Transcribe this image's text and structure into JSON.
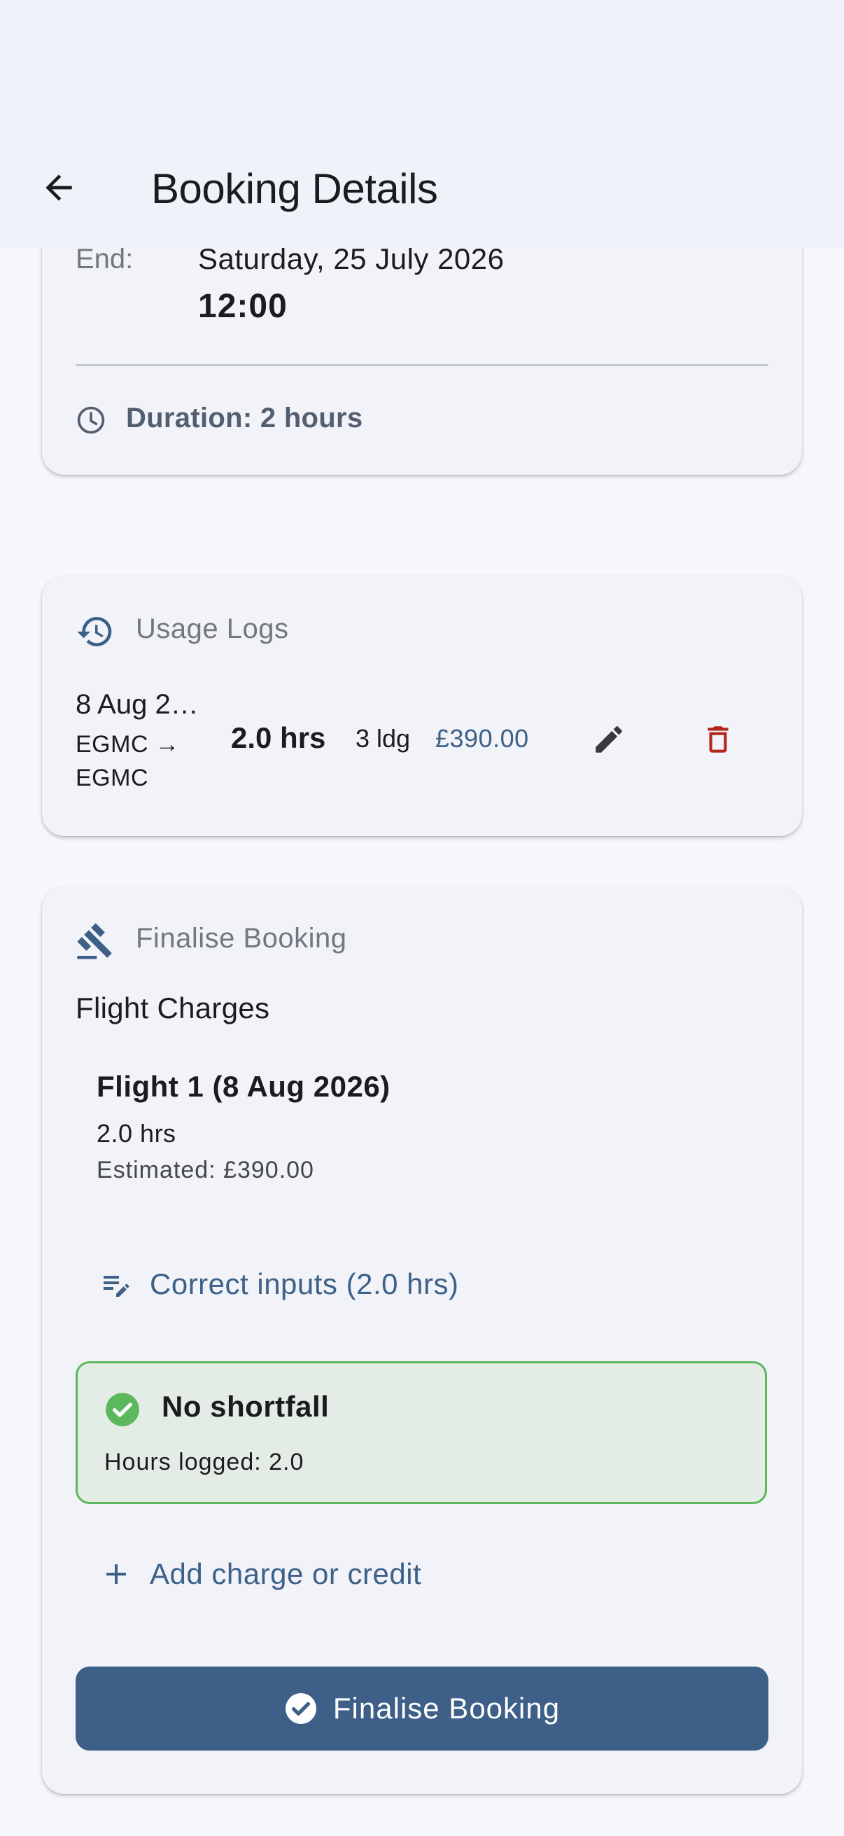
{
  "appbar": {
    "back_icon": "arrow-left-icon",
    "title": "Booking Details"
  },
  "schedule_card": {
    "end_label": "End:",
    "end_date": "Saturday, 25 July 2026",
    "end_time": "12:00",
    "duration_icon": "clock-icon",
    "duration": "Duration: 2 hours"
  },
  "usage_logs": {
    "icon": "history-icon",
    "title": "Usage Logs",
    "entries": [
      {
        "date": "8 Aug 2…",
        "route_line1": "EGMC →",
        "route_line2": "EGMC",
        "hours": "2.0 hrs",
        "landings": "3 ldg",
        "cost": "£390.00",
        "edit_icon": "pencil-icon",
        "delete_icon": "trash-icon"
      }
    ]
  },
  "finalise": {
    "icon": "gavel-icon",
    "title": "Finalise Booking",
    "flight_charges_label": "Flight Charges",
    "flights": [
      {
        "title": "Flight 1 (8 Aug 2026)",
        "hours": "2.0 hrs",
        "estimated": "Estimated: £390.00"
      }
    ],
    "correct_inputs_label": "Correct inputs (2.0 hrs)",
    "correct_inputs_icon": "edit-note-icon",
    "status": {
      "icon": "check-circle-icon",
      "title": "No shortfall",
      "detail": "Hours logged: 2.0",
      "color": "#5cb85c"
    },
    "add_charge_label": "Add charge or credit",
    "add_charge_icon": "plus-icon",
    "finalise_button_label": "Finalise Booking",
    "finalise_button_icon": "check-circle-icon"
  },
  "colors": {
    "primary": "#3d5f88",
    "delete": "#b3261e",
    "background": "#f5f7fc",
    "appbar": "#eff2f9"
  }
}
